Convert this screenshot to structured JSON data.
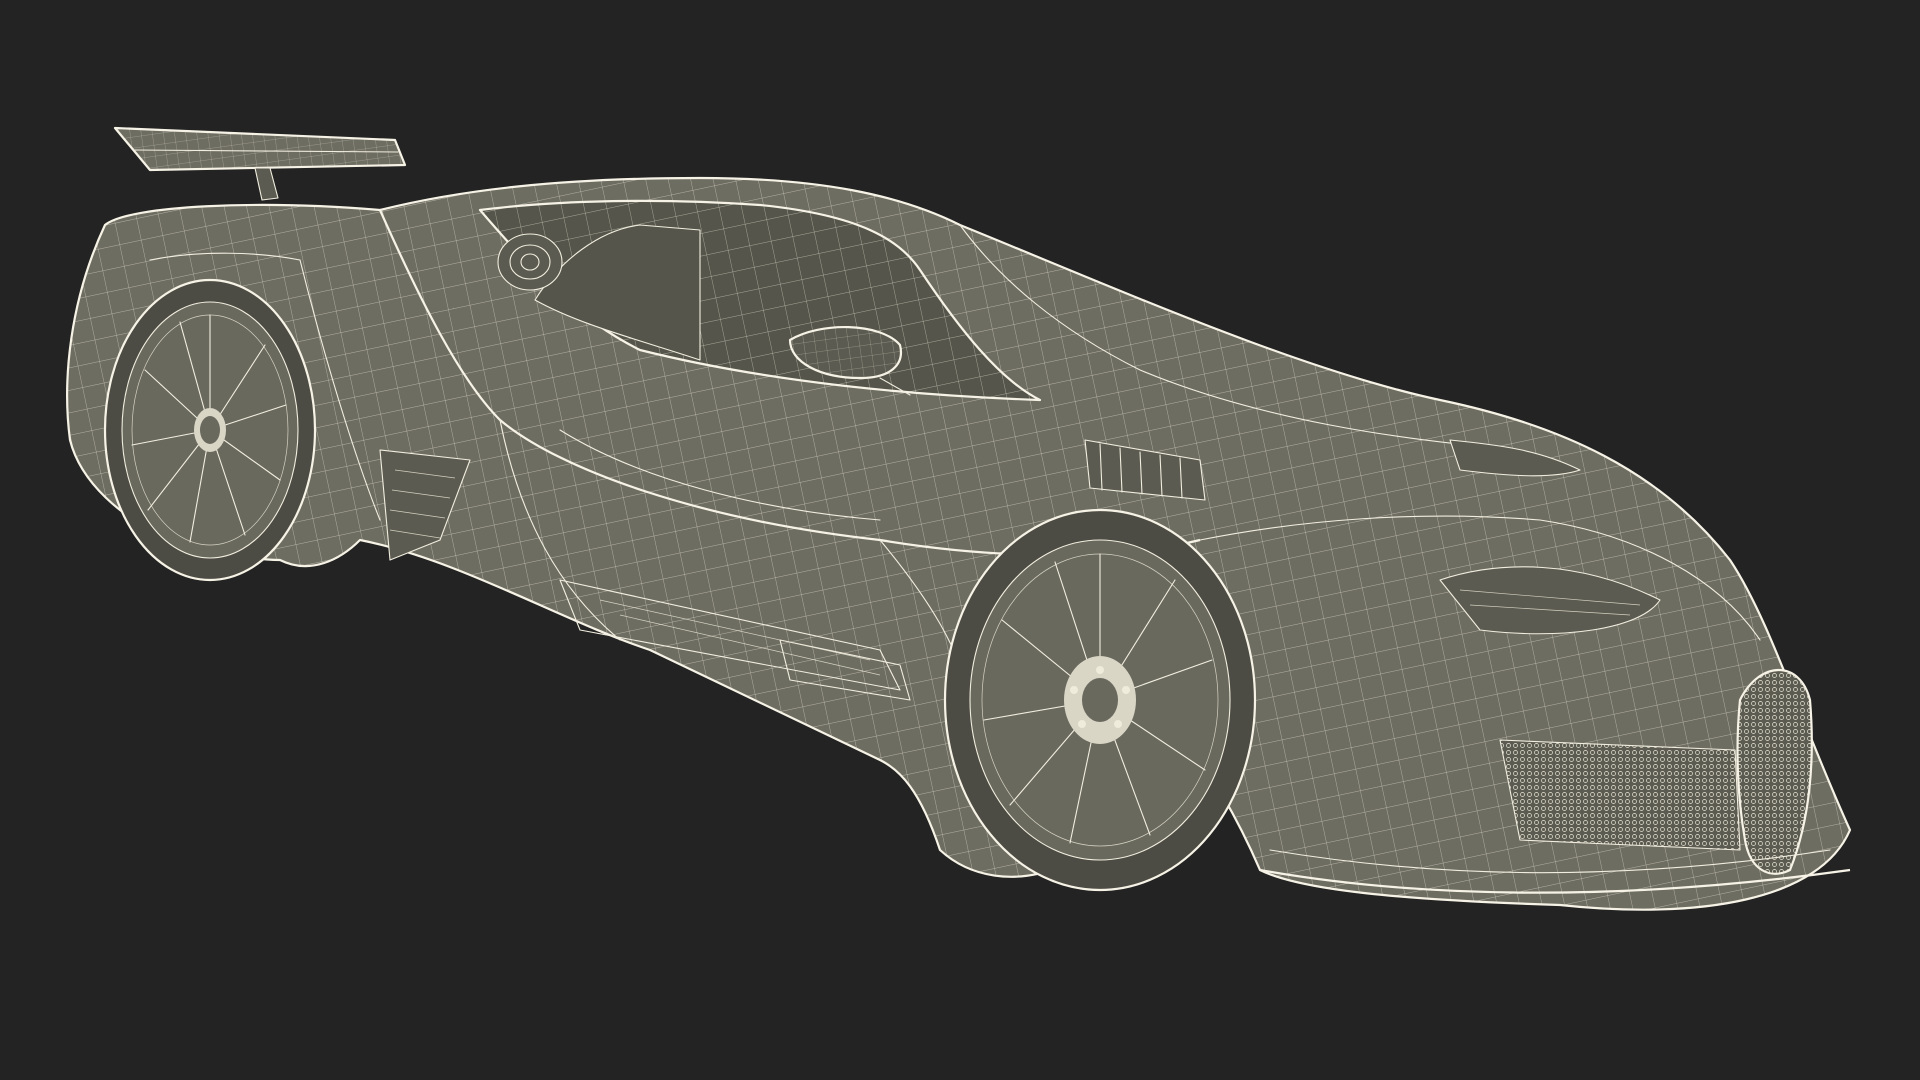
{
  "scene": {
    "subject": "car-wireframe-render",
    "colors": {
      "background": "#232323",
      "body": "#6e6d62",
      "wire": "#f1eedf"
    }
  }
}
